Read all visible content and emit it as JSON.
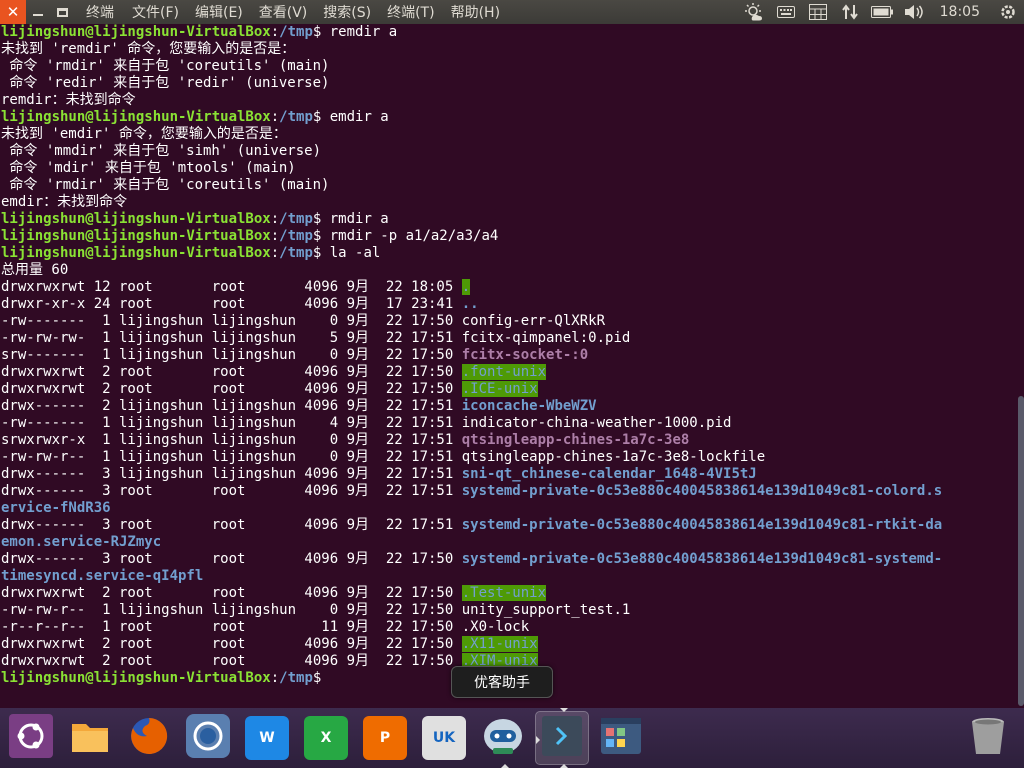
{
  "topbar": {
    "title": "终端",
    "menu": [
      "文件(F)",
      "编辑(E)",
      "查看(V)",
      "搜索(S)",
      "终端(T)",
      "帮助(H)"
    ],
    "clock": "18:05"
  },
  "tooltip": "优客助手",
  "colors": {
    "accent": "#e95420",
    "terminal_bg": "#300a24",
    "prompt_user": "#8ae234",
    "prompt_path": "#729fcf",
    "sticky_bg": "#4e9a06",
    "socket": "#ad7fa8"
  },
  "terminal": {
    "prompt": {
      "user": "lijingshun@lijingshun-VirtualBox",
      "sep": ":",
      "path": "/tmp",
      "sym": "$ "
    },
    "lines": [
      [
        {
          "t": "prompt"
        },
        {
          "t": "remdir a"
        }
      ],
      [
        {
          "t": "未找到 'remdir' 命令，您要输入的是否是："
        }
      ],
      [
        {
          "t": " 命令 'rmdir' 来自于包 'coreutils' (main)"
        }
      ],
      [
        {
          "t": " 命令 'redir' 来自于包 'redir' (universe)"
        }
      ],
      [
        {
          "t": "remdir：未找到命令"
        }
      ],
      [
        {
          "t": "prompt"
        },
        {
          "t": "emdir a"
        }
      ],
      [
        {
          "t": "未找到 'emdir' 命令，您要输入的是否是："
        }
      ],
      [
        {
          "t": " 命令 'mmdir' 来自于包 'simh' (universe)"
        }
      ],
      [
        {
          "t": " 命令 'mdir' 来自于包 'mtools' (main)"
        }
      ],
      [
        {
          "t": " 命令 'rmdir' 来自于包 'coreutils' (main)"
        }
      ],
      [
        {
          "t": "emdir：未找到命令"
        }
      ],
      [
        {
          "t": "prompt"
        },
        {
          "t": "rmdir a"
        }
      ],
      [
        {
          "t": "prompt"
        },
        {
          "t": "rmdir -p a1/a2/a3/a4"
        }
      ],
      [
        {
          "t": "prompt"
        },
        {
          "t": "la -al"
        }
      ],
      [
        {
          "t": "总用量 60"
        }
      ],
      [
        {
          "t": "drwxrwxrwt 12 root       root       4096 9月  22 18:05 "
        },
        {
          "t": ".",
          "c": "sticky"
        }
      ],
      [
        {
          "t": "drwxr-xr-x 24 root       root       4096 9月  17 23:41 "
        },
        {
          "t": "..",
          "c": "dir"
        }
      ],
      [
        {
          "t": "-rw-------  1 lijingshun lijingshun    0 9月  22 17:50 config-err-QlXRkR"
        }
      ],
      [
        {
          "t": "-rw-rw-rw-  1 lijingshun lijingshun    5 9月  22 17:51 fcitx-qimpanel:0.pid"
        }
      ],
      [
        {
          "t": "srw-------  1 lijingshun lijingshun    0 9月  22 17:50 "
        },
        {
          "t": "fcitx-socket-:0",
          "c": "sock"
        }
      ],
      [
        {
          "t": "drwxrwxrwt  2 root       root       4096 9月  22 17:50 "
        },
        {
          "t": ".font-unix",
          "c": "sticky"
        }
      ],
      [
        {
          "t": "drwxrwxrwt  2 root       root       4096 9月  22 17:50 "
        },
        {
          "t": ".ICE-unix",
          "c": "sticky"
        }
      ],
      [
        {
          "t": "drwx------  2 lijingshun lijingshun 4096 9月  22 17:51 "
        },
        {
          "t": "iconcache-WbeWZV",
          "c": "dir"
        }
      ],
      [
        {
          "t": "-rw-------  1 lijingshun lijingshun    4 9月  22 17:51 indicator-china-weather-1000.pid"
        }
      ],
      [
        {
          "t": "srwxrwxr-x  1 lijingshun lijingshun    0 9月  22 17:51 "
        },
        {
          "t": "qtsingleapp-chines-1a7c-3e8",
          "c": "sock"
        }
      ],
      [
        {
          "t": "-rw-rw-r--  1 lijingshun lijingshun    0 9月  22 17:51 qtsingleapp-chines-1a7c-3e8-lockfile"
        }
      ],
      [
        {
          "t": "drwx------  3 lijingshun lijingshun 4096 9月  22 17:51 "
        },
        {
          "t": "sni-qt_chinese-calendar_1648-4VI5tJ",
          "c": "dir"
        }
      ],
      [
        {
          "t": "drwx------  3 root       root       4096 9月  22 17:51 "
        },
        {
          "t": "systemd-private-0c53e880c40045838614e139d1049c81-colord.s",
          "c": "dir"
        }
      ],
      [
        {
          "t": "ervice-fNdR36",
          "c": "dir"
        }
      ],
      [
        {
          "t": "drwx------  3 root       root       4096 9月  22 17:51 "
        },
        {
          "t": "systemd-private-0c53e880c40045838614e139d1049c81-rtkit-da",
          "c": "dir"
        }
      ],
      [
        {
          "t": "emon.service-RJZmyc",
          "c": "dir"
        }
      ],
      [
        {
          "t": "drwx------  3 root       root       4096 9月  22 17:50 "
        },
        {
          "t": "systemd-private-0c53e880c40045838614e139d1049c81-systemd-",
          "c": "dir"
        }
      ],
      [
        {
          "t": "timesyncd.service-qI4pfl",
          "c": "dir"
        }
      ],
      [
        {
          "t": "drwxrwxrwt  2 root       root       4096 9月  22 17:50 "
        },
        {
          "t": ".Test-unix",
          "c": "sticky"
        }
      ],
      [
        {
          "t": "-rw-rw-r--  1 lijingshun lijingshun    0 9月  22 17:50 unity_support_test.1"
        }
      ],
      [
        {
          "t": "-r--r--r--  1 root       root         11 9月  22 17:50 .X0-lock"
        }
      ],
      [
        {
          "t": "drwxrwxrwt  2 root       root       4096 9月  22 17:50 "
        },
        {
          "t": ".X11-unix",
          "c": "sticky"
        }
      ],
      [
        {
          "t": "drwxrwxrwt  2 root       root       4096 9月  22 17:50 "
        },
        {
          "t": ".XIM-unix",
          "c": "sticky"
        }
      ],
      [
        {
          "t": "prompt"
        }
      ]
    ]
  },
  "dock": [
    {
      "name": "ubuntu-dash",
      "icon": "ubuntu-logo-icon",
      "color": "#7a3e84"
    },
    {
      "name": "files",
      "icon": "folder-icon",
      "color": "#f4a83a"
    },
    {
      "name": "firefox",
      "icon": "firefox-icon",
      "color": "#e66000"
    },
    {
      "name": "browser",
      "icon": "globe-icon",
      "color": "#5a7fb0"
    },
    {
      "name": "wps-writer",
      "icon": "writer-icon",
      "label": "W",
      "color": "#1e88e5"
    },
    {
      "name": "wps-spreadsheets",
      "icon": "spreadsheet-icon",
      "label": "X",
      "color": "#27a844"
    },
    {
      "name": "wps-presentation",
      "icon": "presentation-icon",
      "label": "P",
      "color": "#ef6c00"
    },
    {
      "name": "uk-software-center",
      "icon": "shopping-bag-icon",
      "label": "UK",
      "color": "#e0e0e0"
    },
    {
      "name": "youker-assistant",
      "icon": "robot-icon",
      "color": "#9fb6c8"
    },
    {
      "name": "terminal",
      "icon": "terminal-icon",
      "color": "#3c4a5a"
    },
    {
      "name": "workspace-switcher",
      "icon": "workspaces-icon",
      "color": "#4a6fa5"
    },
    {
      "name": "trash",
      "icon": "trash-icon",
      "color": "#8a8a8a"
    }
  ]
}
